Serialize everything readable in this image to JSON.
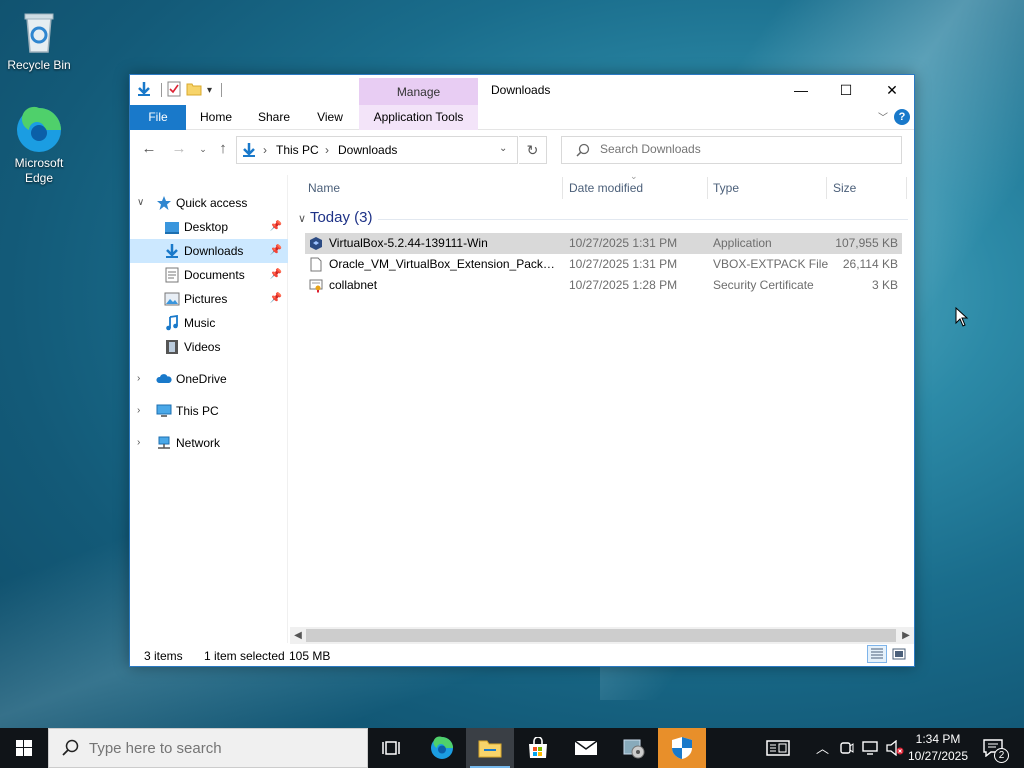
{
  "desktop": {
    "icons": [
      {
        "label": "Recycle Bin"
      },
      {
        "label": "Microsoft Edge"
      }
    ]
  },
  "window": {
    "title": "Downloads",
    "contextual_tab_group": "Manage",
    "ribbon_tabs": [
      "File",
      "Home",
      "Share",
      "View",
      "Application Tools"
    ],
    "controls": {
      "minimize": "—",
      "maximize": "☐",
      "close": "✕"
    }
  },
  "address": {
    "crumbs": [
      "This PC",
      "Downloads"
    ],
    "search_placeholder": "Search Downloads"
  },
  "nav": {
    "items": [
      {
        "label": "Quick access"
      },
      {
        "label": "Desktop"
      },
      {
        "label": "Downloads"
      },
      {
        "label": "Documents"
      },
      {
        "label": "Pictures"
      },
      {
        "label": "Music"
      },
      {
        "label": "Videos"
      },
      {
        "label": "OneDrive"
      },
      {
        "label": "This PC"
      },
      {
        "label": "Network"
      }
    ]
  },
  "list": {
    "columns": [
      "Name",
      "Date modified",
      "Type",
      "Size"
    ],
    "group_label": "Today (3)",
    "rows": [
      {
        "name": "VirtualBox-5.2.44-139111-Win",
        "date": "10/27/2025 1:31 PM",
        "type": "Application",
        "size": "107,955 KB"
      },
      {
        "name": "Oracle_VM_VirtualBox_Extension_Pack-5....",
        "date": "10/27/2025 1:31 PM",
        "type": "VBOX-EXTPACK File",
        "size": "26,114 KB"
      },
      {
        "name": "collabnet",
        "date": "10/27/2025 1:28 PM",
        "type": "Security Certificate",
        "size": "3 KB"
      }
    ]
  },
  "status": {
    "items_count": "3 items",
    "selected": "1 item selected",
    "selected_size": "105 MB"
  },
  "taskbar": {
    "search_placeholder": "Type here to search",
    "time": "1:34 PM",
    "date": "10/27/2025",
    "notification_count": "2"
  },
  "colors": {
    "accent": "#1979ca",
    "selection": "#cce8ff",
    "manage_tab": "#e8cdf3",
    "taskbar": "#101418"
  }
}
